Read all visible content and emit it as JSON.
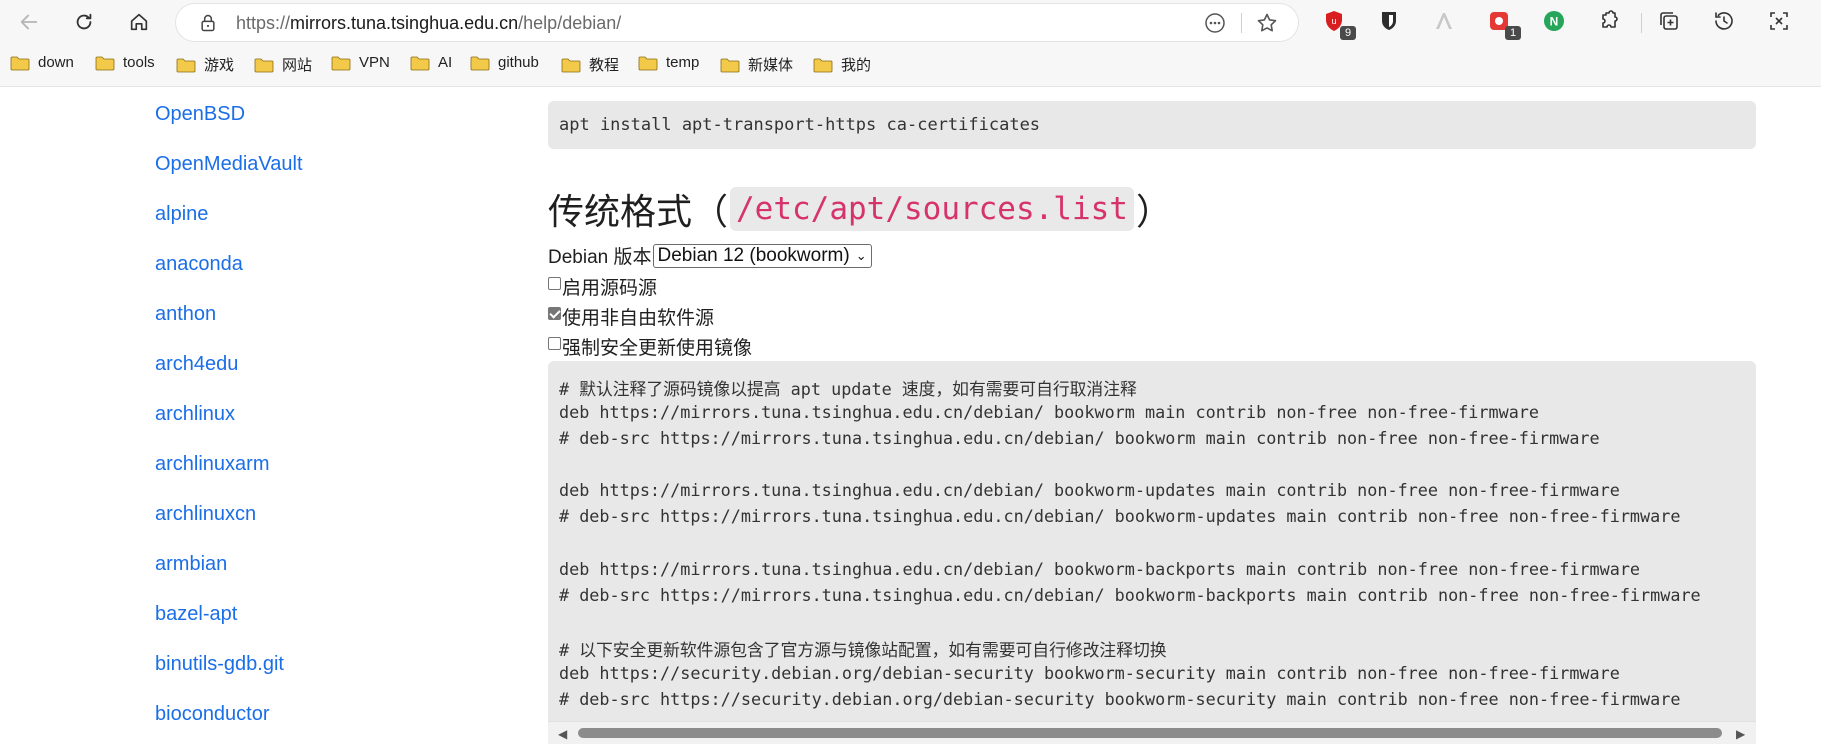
{
  "browser": {
    "url_prefix": "https://",
    "url_host": "mirrors.tuna.tsinghua.edu.cn",
    "url_path": "/help/debian/",
    "extensions": [
      {
        "name": "ublock-icon",
        "badge": "9"
      },
      {
        "name": "bitwarden-icon",
        "badge": ""
      },
      {
        "name": "extension-a-icon",
        "badge": ""
      },
      {
        "name": "extension-red-icon",
        "badge": "1"
      },
      {
        "name": "nuxt-devtools-icon",
        "badge": ""
      }
    ]
  },
  "bookmarks": [
    "down",
    "tools",
    "游戏",
    "网站",
    "VPN",
    "AI",
    "github",
    "教程",
    "temp",
    "新媒体",
    "我的"
  ],
  "sidebar": {
    "items": [
      "OpenBSD",
      "OpenMediaVault",
      "alpine",
      "anaconda",
      "anthon",
      "arch4edu",
      "archlinux",
      "archlinuxarm",
      "archlinuxcn",
      "armbian",
      "bazel-apt",
      "binutils-gdb.git",
      "bioconductor"
    ]
  },
  "main": {
    "install_cmd": "apt install apt-transport-https ca-certificates",
    "heading_prefix": "传统格式（",
    "heading_code": "/etc/apt/sources.list",
    "heading_suffix": "）",
    "version_label": "Debian 版本",
    "version_selected": "Debian 12 (bookworm)",
    "options": [
      {
        "label": "启用源码源",
        "checked": false
      },
      {
        "label": "使用非自由软件源",
        "checked": true
      },
      {
        "label": "强制安全更新使用镜像",
        "checked": false
      }
    ],
    "sources_lines": [
      "# 默认注释了源码镜像以提高 apt update 速度，如有需要可自行取消注释",
      "deb https://mirrors.tuna.tsinghua.edu.cn/debian/ bookworm main contrib non-free non-free-firmware",
      "# deb-src https://mirrors.tuna.tsinghua.edu.cn/debian/ bookworm main contrib non-free non-free-firmware",
      "",
      "deb https://mirrors.tuna.tsinghua.edu.cn/debian/ bookworm-updates main contrib non-free non-free-firmware",
      "# deb-src https://mirrors.tuna.tsinghua.edu.cn/debian/ bookworm-updates main contrib non-free non-free-firmware",
      "",
      "deb https://mirrors.tuna.tsinghua.edu.cn/debian/ bookworm-backports main contrib non-free non-free-firmware",
      "# deb-src https://mirrors.tuna.tsinghua.edu.cn/debian/ bookworm-backports main contrib non-free non-free-firmware",
      "",
      "# 以下安全更新软件源包含了官方源与镜像站配置，如有需要可自行修改注释切换",
      "deb https://security.debian.org/debian-security bookworm-security main contrib non-free non-free-firmware",
      "# deb-src https://security.debian.org/debian-security bookworm-security main contrib non-free non-free-firmware"
    ]
  },
  "colors": {
    "link": "#1a6ee8",
    "inline_code": "#d6336c",
    "code_bg": "#e8e8e8"
  }
}
